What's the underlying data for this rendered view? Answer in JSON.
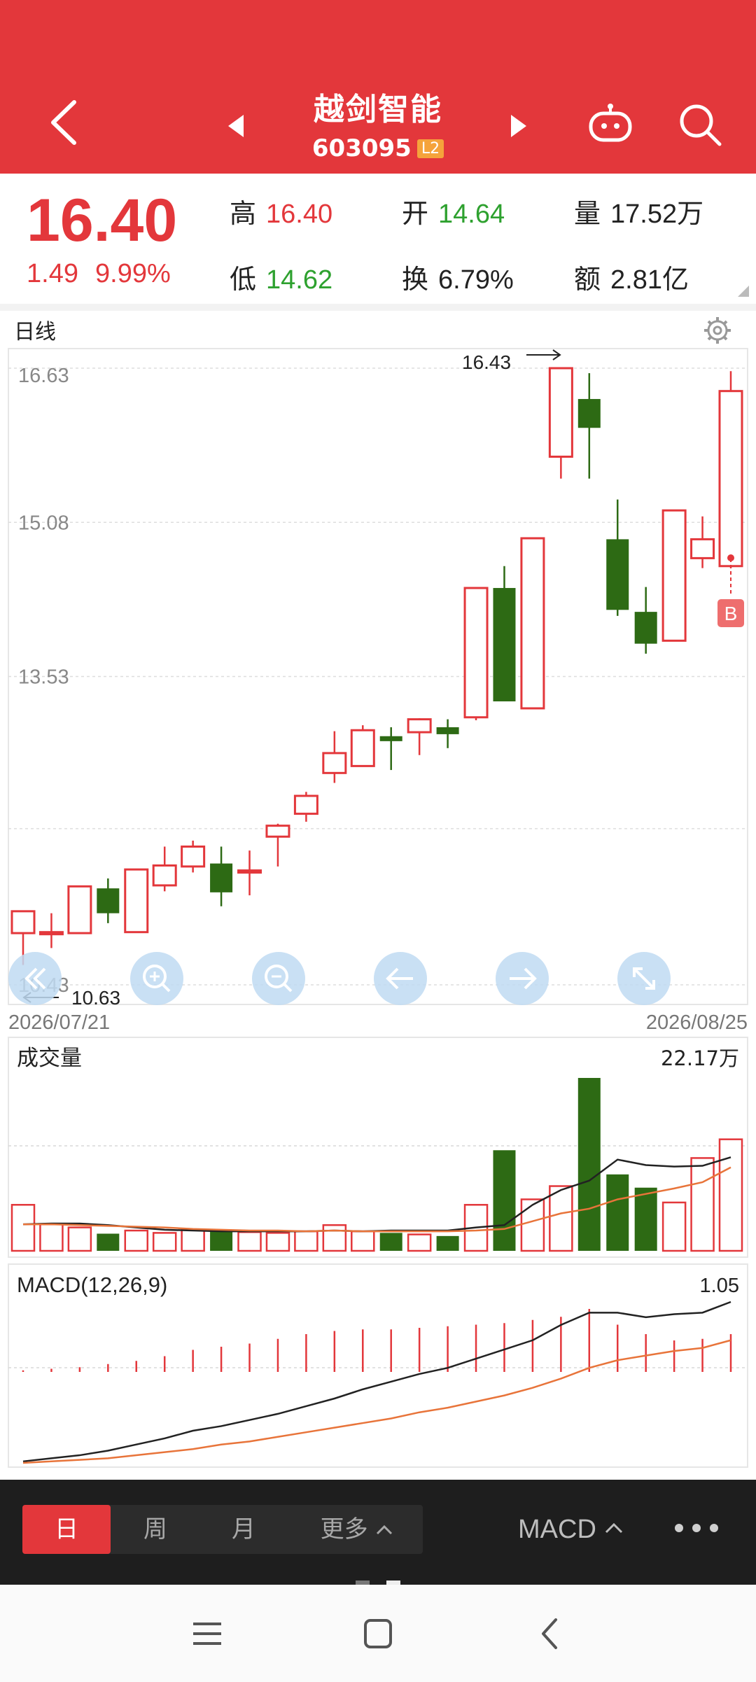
{
  "header": {
    "title": "越剑智能",
    "code": "603095",
    "badge": "L2"
  },
  "quote": {
    "price": "16.40",
    "change": "1.49",
    "change_pct": "9.99%",
    "high_label": "高",
    "high": "16.40",
    "open_label": "开",
    "open": "14.64",
    "volume_label": "量",
    "volume": "17.52万",
    "low_label": "低",
    "low": "14.62",
    "turnover_label": "换",
    "turnover": "6.79%",
    "amount_label": "额",
    "amount": "2.81亿"
  },
  "kline_panel": {
    "title": "日线",
    "start_date": "2026/07/21",
    "end_date": "2026/08/25",
    "max_marker": "16.43",
    "min_marker": "10.63",
    "buy_marker": "B"
  },
  "volume_panel": {
    "title": "成交量",
    "max_label": "22.17万"
  },
  "macd_panel": {
    "title": "MACD(12,26,9)",
    "max_label": "1.05"
  },
  "chart_controls": [
    "zoom-left-icon",
    "zoom-in-icon",
    "zoom-out-icon",
    "arrow-left-icon",
    "arrow-right-icon",
    "expand-icon"
  ],
  "toolbar": {
    "day": "日",
    "week": "周",
    "month": "月",
    "more": "更多",
    "indicator": "MACD"
  },
  "colors": {
    "brand_red": "#e3373b",
    "down_green": "#2d6a14",
    "ma_black": "#222222",
    "ma_orange": "#e8743a"
  },
  "chart_data": [
    {
      "type": "candlestick",
      "title": "日线",
      "ylim": [
        10.43,
        16.63
      ],
      "y_ticks": [
        "16.63",
        "15.08",
        "13.53",
        "10.43"
      ],
      "x_range_labels": [
        "2026/07/21",
        "2026/08/25"
      ],
      "candles": [
        {
          "o": 10.95,
          "c": 11.17,
          "h": 11.17,
          "l": 10.63
        },
        {
          "o": 10.96,
          "c": 10.96,
          "h": 11.15,
          "l": 10.8
        },
        {
          "o": 10.95,
          "c": 11.42,
          "h": 11.42,
          "l": 10.95
        },
        {
          "o": 11.4,
          "c": 11.15,
          "h": 11.5,
          "l": 11.05
        },
        {
          "o": 10.96,
          "c": 11.59,
          "h": 11.59,
          "l": 10.96
        },
        {
          "o": 11.43,
          "c": 11.63,
          "h": 11.82,
          "l": 11.37
        },
        {
          "o": 11.62,
          "c": 11.82,
          "h": 11.88,
          "l": 11.56
        },
        {
          "o": 11.65,
          "c": 11.36,
          "h": 11.82,
          "l": 11.22
        },
        {
          "o": 11.58,
          "c": 11.58,
          "h": 11.78,
          "l": 11.33
        },
        {
          "o": 11.92,
          "c": 12.03,
          "h": 12.05,
          "l": 11.62
        },
        {
          "o": 12.15,
          "c": 12.33,
          "h": 12.37,
          "l": 12.07
        },
        {
          "o": 12.56,
          "c": 12.76,
          "h": 12.98,
          "l": 12.46
        },
        {
          "o": 12.63,
          "c": 12.99,
          "h": 13.04,
          "l": 12.63
        },
        {
          "o": 12.93,
          "c": 12.88,
          "h": 13.02,
          "l": 12.59
        },
        {
          "o": 12.97,
          "c": 13.1,
          "h": 13.11,
          "l": 12.74
        },
        {
          "o": 13.02,
          "c": 12.95,
          "h": 13.1,
          "l": 12.81
        },
        {
          "o": 13.12,
          "c": 14.42,
          "h": 14.42,
          "l": 13.09
        },
        {
          "o": 14.42,
          "c": 13.28,
          "h": 14.64,
          "l": 13.28
        },
        {
          "o": 13.21,
          "c": 14.92,
          "h": 14.92,
          "l": 13.21
        },
        {
          "o": 15.74,
          "c": 16.63,
          "h": 16.63,
          "l": 15.52
        },
        {
          "o": 16.32,
          "c": 16.03,
          "h": 16.58,
          "l": 15.52
        },
        {
          "o": 14.91,
          "c": 14.2,
          "h": 15.31,
          "l": 14.14
        },
        {
          "o": 14.18,
          "c": 13.86,
          "h": 14.43,
          "l": 13.76
        },
        {
          "o": 13.89,
          "c": 15.2,
          "h": 15.2,
          "l": 13.89
        },
        {
          "o": 14.72,
          "c": 14.91,
          "h": 15.14,
          "l": 14.62
        },
        {
          "o": 14.64,
          "c": 16.4,
          "h": 16.6,
          "l": 14.62
        }
      ]
    },
    {
      "type": "bar",
      "title": "成交量",
      "ylim": [
        0,
        22.17
      ],
      "values": [
        5.9,
        3.4,
        3.0,
        2.2,
        2.6,
        2.3,
        2.7,
        2.7,
        2.4,
        2.3,
        2.5,
        3.3,
        2.5,
        2.3,
        2.1,
        1.9,
        5.9,
        12.9,
        6.6,
        8.3,
        22.17,
        9.8,
        8.1,
        6.2,
        11.9,
        14.3
      ],
      "down": [
        false,
        false,
        false,
        true,
        false,
        false,
        false,
        true,
        false,
        false,
        false,
        false,
        false,
        true,
        false,
        true,
        false,
        true,
        false,
        false,
        true,
        true,
        true,
        false,
        false,
        false
      ],
      "series": [
        {
          "name": "MA5",
          "values": [
            3.4,
            3.5,
            3.5,
            3.3,
            3.0,
            2.7,
            2.6,
            2.5,
            2.5,
            2.5,
            2.5,
            2.6,
            2.5,
            2.6,
            2.6,
            2.6,
            3.0,
            3.3,
            5.9,
            7.8,
            9.0,
            11.7,
            11.0,
            10.8,
            10.9,
            12.0
          ]
        },
        {
          "name": "MA10",
          "values": [
            3.4,
            3.4,
            3.3,
            3.2,
            3.1,
            3.0,
            2.8,
            2.7,
            2.6,
            2.6,
            2.5,
            2.6,
            2.5,
            2.5,
            2.5,
            2.5,
            2.6,
            2.8,
            3.8,
            4.8,
            5.4,
            6.6,
            7.3,
            8.0,
            8.8,
            10.7
          ]
        }
      ]
    },
    {
      "type": "bar",
      "title": "MACD(12,26,9)",
      "ylim": [
        0,
        1.05
      ],
      "values": [
        0.01,
        0.02,
        0.03,
        0.05,
        0.07,
        0.1,
        0.14,
        0.16,
        0.18,
        0.21,
        0.24,
        0.26,
        0.27,
        0.27,
        0.28,
        0.29,
        0.3,
        0.31,
        0.33,
        0.35,
        0.4,
        0.3,
        0.24,
        0.2,
        0.21,
        0.24
      ],
      "series": [
        {
          "name": "DIF",
          "values": [
            0.01,
            0.03,
            0.05,
            0.08,
            0.12,
            0.16,
            0.21,
            0.24,
            0.28,
            0.32,
            0.37,
            0.42,
            0.48,
            0.53,
            0.58,
            0.62,
            0.68,
            0.74,
            0.8,
            0.9,
            0.98,
            0.98,
            0.95,
            0.97,
            0.98,
            1.05
          ]
        },
        {
          "name": "DEA",
          "values": [
            0.0,
            0.01,
            0.02,
            0.03,
            0.05,
            0.07,
            0.09,
            0.12,
            0.14,
            0.17,
            0.2,
            0.23,
            0.26,
            0.29,
            0.33,
            0.36,
            0.4,
            0.44,
            0.49,
            0.55,
            0.62,
            0.67,
            0.7,
            0.73,
            0.75,
            0.8
          ]
        }
      ]
    }
  ]
}
